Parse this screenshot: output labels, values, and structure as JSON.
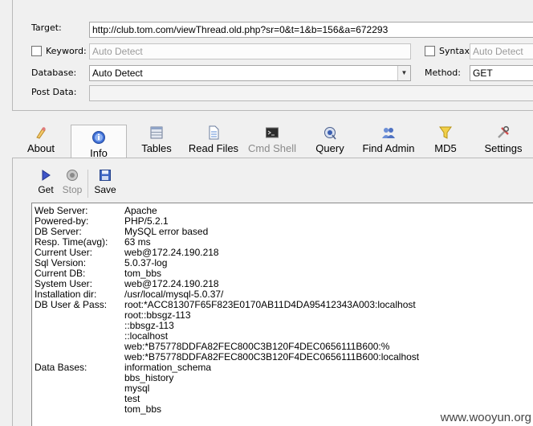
{
  "params": {
    "target_label": "Target:",
    "target_value": "http://club.tom.com/viewThread.old.php?sr=0&t=1&b=156&a=672293",
    "keyword_label": "Keyword:",
    "keyword_placeholder": "Auto Detect",
    "syntax_label": "Syntax:",
    "syntax_placeholder": "Auto Detect",
    "database_label": "Database:",
    "database_value": "Auto Detect",
    "method_label": "Method:",
    "method_value": "GET",
    "postdata_label": "Post Data:"
  },
  "toolbar": {
    "about": "About",
    "info": "Info",
    "tables": "Tables",
    "read_files": "Read Files",
    "cmd_shell": "Cmd Shell",
    "query": "Query",
    "find_admin": "Find Admin",
    "md5": "MD5",
    "settings": "Settings"
  },
  "subtoolbar": {
    "get": "Get",
    "stop": "Stop",
    "save": "Save"
  },
  "info_rows": [
    {
      "key": "Web Server:",
      "value": "Apache"
    },
    {
      "key": "Powered-by:",
      "value": "PHP/5.2.1"
    },
    {
      "key": "DB Server:",
      "value": "MySQL error based"
    },
    {
      "key": "Resp. Time(avg):",
      "value": "63 ms"
    },
    {
      "key": "Current User:",
      "value": "web@172.24.190.218"
    },
    {
      "key": "Sql Version:",
      "value": "5.0.37-log"
    },
    {
      "key": "Current DB:",
      "value": "tom_bbs"
    },
    {
      "key": "System User:",
      "value": "web@172.24.190.218"
    },
    {
      "key": "Installation dir:",
      "value": "/usr/local/mysql-5.0.37/"
    },
    {
      "key": "DB User & Pass:",
      "value": "root:*ACC81307F65F823E0170AB11D4DA95412343A003:localhost"
    },
    {
      "key": "",
      "value": "root::bbsgz-113"
    },
    {
      "key": "",
      "value": "::bbsgz-113"
    },
    {
      "key": "",
      "value": "::localhost"
    },
    {
      "key": "",
      "value": "web:*B75778DDFA82FEC800C3B120F4DEC0656111B600:%"
    },
    {
      "key": "",
      "value": "web:*B75778DDFA82FEC800C3B120F4DEC0656111B600:localhost"
    },
    {
      "key": "Data Bases:",
      "value": "information_schema"
    },
    {
      "key": "",
      "value": "bbs_history"
    },
    {
      "key": "",
      "value": "mysql"
    },
    {
      "key": "",
      "value": "test"
    },
    {
      "key": "",
      "value": "tom_bbs"
    }
  ],
  "watermark": "www.wooyun.org",
  "icons": [
    "about-icon",
    "info-icon",
    "tables-icon",
    "read-files-icon",
    "cmd-shell-icon",
    "query-icon",
    "find-admin-icon",
    "md5-icon",
    "settings-icon",
    "get-icon",
    "stop-icon",
    "save-icon"
  ]
}
